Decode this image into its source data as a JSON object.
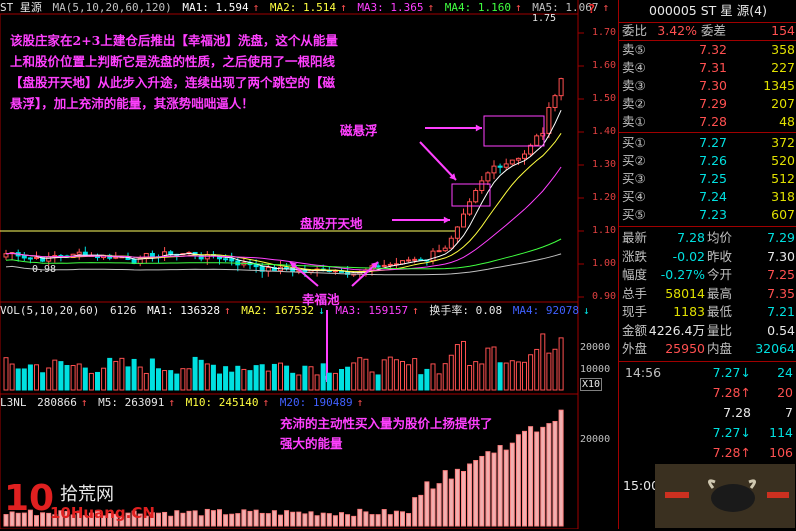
{
  "header": {
    "stock_name": "ST 星源",
    "ma_params": "MA(5,10,20,60,120)",
    "ma1": "MA1: 1.594",
    "ma2": "MA2: 1.514",
    "ma3": "MA3: 1.365",
    "ma4": "MA4: 1.160",
    "ma5": "MA5: 1.067",
    "high_mark": "1.75",
    "low_mark": "0.98",
    "question": "?"
  },
  "price_axis": [
    "1.70",
    "1.60",
    "1.50",
    "1.40",
    "1.30",
    "1.20",
    "1.10",
    "1.00",
    "0.90"
  ],
  "vol_header": {
    "label": "VOL(5,10,20,60)",
    "vol": "6126",
    "ma1": "MA1: 136328",
    "ma2": "MA2: 167532",
    "ma3": "MA3: 159157",
    "turnover": "换手率: 0.08",
    "ma4": "MA4: 92078"
  },
  "vol_axis": [
    "20000",
    "10000"
  ],
  "vol_unit": "X10",
  "l3nl_header": {
    "label": "L3NL",
    "value": "280866",
    "m5": "M5: 263091",
    "m10": "M10: 245140",
    "m20": "M20: 190489"
  },
  "l3nl_axis": [
    "20000"
  ],
  "annotations": {
    "main": "该股庄家在2+3上建仓后推出【幸福池】洗盘，这个从能量上和股价位置上判断它是洗盘的性质，之后使用了一根阳线【盘股开天地】从此步入升途，连续出现了两个跳空的【磁悬浮】，加上充沛的能量，其涨势咄咄逼人！",
    "cixuanfu": "磁悬浮",
    "panggu": "盘股开天地",
    "xingfuchi": "幸福池",
    "vol_note": "充沛的主动性买入量为股价上扬提供了强大的能量"
  },
  "logo": {
    "brand": "拾荒网",
    "site": "10Huang.CN"
  },
  "quote_panel": {
    "title": "000005 ST 星 源(4)",
    "weibi_label": "委比",
    "weibi_value": "3.42%",
    "weicha_label": "委差",
    "weicha_value": "154",
    "sells": [
      {
        "label": "卖⑤",
        "price": "7.32",
        "vol": "358"
      },
      {
        "label": "卖④",
        "price": "7.31",
        "vol": "227"
      },
      {
        "label": "卖③",
        "price": "7.30",
        "vol": "1345"
      },
      {
        "label": "卖②",
        "price": "7.29",
        "vol": "207"
      },
      {
        "label": "卖①",
        "price": "7.28",
        "vol": "48"
      }
    ],
    "buys": [
      {
        "label": "买①",
        "price": "7.27",
        "vol": "372"
      },
      {
        "label": "买②",
        "price": "7.26",
        "vol": "520"
      },
      {
        "label": "买③",
        "price": "7.25",
        "vol": "512"
      },
      {
        "label": "买④",
        "price": "7.24",
        "vol": "318"
      },
      {
        "label": "买⑤",
        "price": "7.23",
        "vol": "607"
      }
    ],
    "stats": [
      {
        "l1": "最新",
        "v1": "7.28",
        "l2": "均价",
        "v2": "7.29"
      },
      {
        "l1": "涨跌",
        "v1": "-0.02",
        "l2": "昨收",
        "v2": "7.30"
      },
      {
        "l1": "幅度",
        "v1": "-0.27%",
        "l2": "今开",
        "v2": "7.25"
      },
      {
        "l1": "总手",
        "v1": "58014",
        "l2": "最高",
        "v2": "7.35"
      },
      {
        "l1": "现手",
        "v1": "1183",
        "l2": "最低",
        "v2": "7.21"
      },
      {
        "l1": "金额",
        "v1": "4226.4万",
        "l2": "量比",
        "v2": "0.54"
      },
      {
        "l1": "外盘",
        "v1": "25950",
        "l2": "内盘",
        "v2": "32064"
      }
    ],
    "ticks": [
      {
        "time": "14:56",
        "price": "7.27",
        "dir": "↓",
        "vol": "24"
      },
      {
        "time": "",
        "price": "7.28",
        "dir": "↑",
        "vol": "20"
      },
      {
        "time": "",
        "price": "7.28",
        "dir": "",
        "vol": "7"
      },
      {
        "time": "",
        "price": "7.27",
        "dir": "↓",
        "vol": "114"
      },
      {
        "time": "",
        "price": "7.28",
        "dir": "↑",
        "vol": "106"
      }
    ],
    "bottom_time": "15:00"
  },
  "colors": {
    "up": "#ff5050",
    "down": "#00e0e0",
    "ma1": "#ffffff",
    "ma2": "#ffff40",
    "ma3": "#ff40ff",
    "ma4": "#40ff40",
    "ma5": "#c0c0c0",
    "annotation": "#ff40ff"
  }
}
